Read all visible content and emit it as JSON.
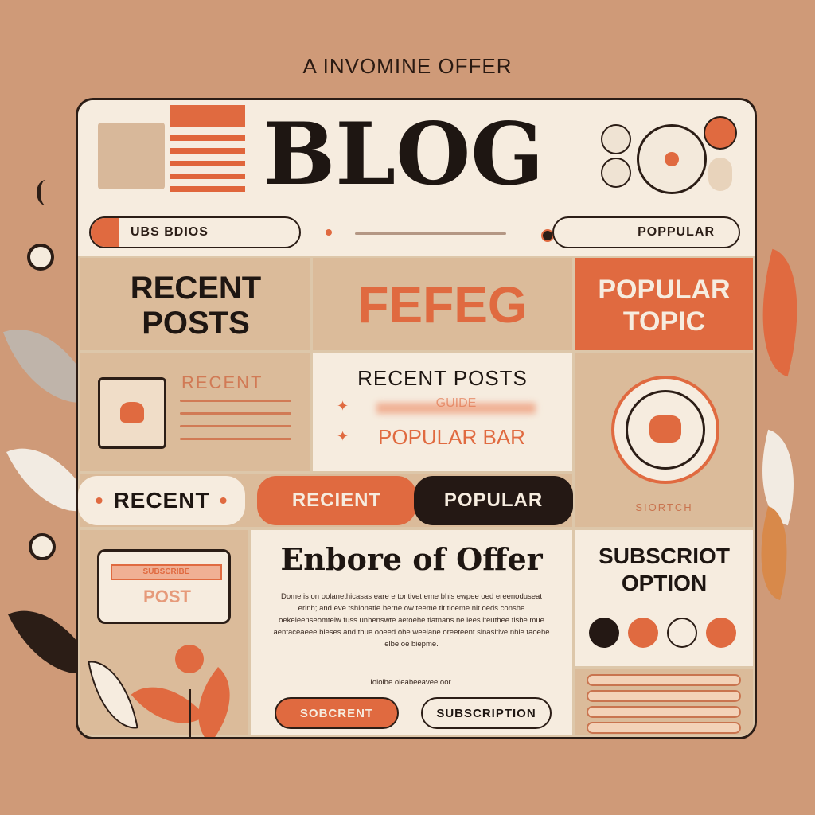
{
  "caption": "A INVOMINE OFFER",
  "header": {
    "title": "BLOG",
    "search_left": "UBS  BDIOS",
    "search_right": "POPPULAR"
  },
  "row1": {
    "recent_posts": "RECENT POSTS",
    "center_label": "FEFEG",
    "popular_topic": "POPULAR TOPIC"
  },
  "row2": {
    "recent_label": "RECENT",
    "center_title": "RECENT POSTS",
    "center_blur": "GUIDE",
    "popular_bar": "POPULAR BAR",
    "right_caption": "SIORTCH"
  },
  "tabs": {
    "recent": "RECENT",
    "recient": "RECIENT",
    "popular": "POPULAR"
  },
  "post_card": {
    "line1": "SUBSCRIBE",
    "line2": "POST"
  },
  "offer": {
    "title": "Enbore of Offer",
    "body": "Dome is on oolanethicasas eare e tontivet eme bhis ewpee oed ereenoduseat erinh; and eve tshionatie berne ow teeme tit tioeme nit oeds conshe oekeieenseomteiw fuss unhenswte aetoehe tiatnans ne lees lteuthee tisbe mue aentaceaeee bieses and thue ooeed ohe weelane oreeteent sinasitive nhie taoehe elbe oe biepme.",
    "footer": "Ioloibe oleabeeavee oor.",
    "btn_primary": "SOBCRENT",
    "btn_secondary": "SUBSCRIPTION"
  },
  "subscribe": {
    "title": "SUBSCRIOT OPTION"
  },
  "colors": {
    "background": "#cf9a78",
    "accent": "#e06a40",
    "cream": "#f6ecdf",
    "sand": "#dbbb9a",
    "ink": "#1e1612"
  }
}
